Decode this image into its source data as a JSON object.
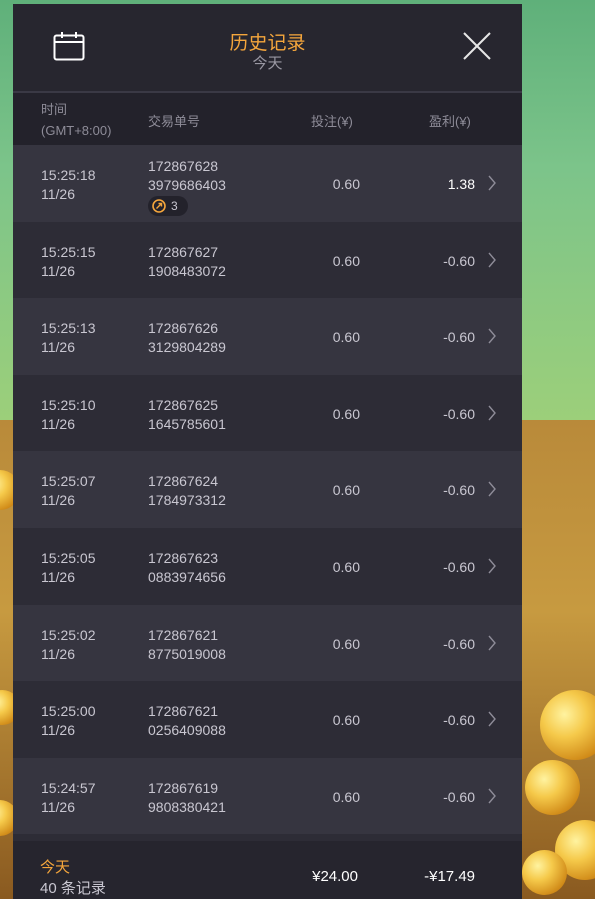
{
  "header": {
    "title": "历史记录",
    "subtitle": "今天"
  },
  "columns": {
    "time_label": "时间",
    "timezone": "(GMT+8:00)",
    "order_label": "交易单号",
    "bet_label": "投注(¥)",
    "profit_label": "盈利(¥)"
  },
  "records": [
    {
      "time": "15:25:18",
      "date": "11/26",
      "order_line1": "172867628",
      "order_line2": "3979686403",
      "bet": "0.60",
      "profit": "1.38",
      "badge_count": "3"
    },
    {
      "time": "15:25:15",
      "date": "11/26",
      "order_line1": "172867627",
      "order_line2": "1908483072",
      "bet": "0.60",
      "profit": "-0.60"
    },
    {
      "time": "15:25:13",
      "date": "11/26",
      "order_line1": "172867626",
      "order_line2": "3129804289",
      "bet": "0.60",
      "profit": "-0.60"
    },
    {
      "time": "15:25:10",
      "date": "11/26",
      "order_line1": "172867625",
      "order_line2": "1645785601",
      "bet": "0.60",
      "profit": "-0.60"
    },
    {
      "time": "15:25:07",
      "date": "11/26",
      "order_line1": "172867624",
      "order_line2": "1784973312",
      "bet": "0.60",
      "profit": "-0.60"
    },
    {
      "time": "15:25:05",
      "date": "11/26",
      "order_line1": "172867623",
      "order_line2": "0883974656",
      "bet": "0.60",
      "profit": "-0.60"
    },
    {
      "time": "15:25:02",
      "date": "11/26",
      "order_line1": "172867621",
      "order_line2": "8775019008",
      "bet": "0.60",
      "profit": "-0.60"
    },
    {
      "time": "15:25:00",
      "date": "11/26",
      "order_line1": "172867621",
      "order_line2": "0256409088",
      "bet": "0.60",
      "profit": "-0.60"
    },
    {
      "time": "15:24:57",
      "date": "11/26",
      "order_line1": "172867619",
      "order_line2": "9808380421",
      "bet": "0.60",
      "profit": "-0.60"
    }
  ],
  "footer": {
    "period": "今天",
    "record_count": "40 条记录",
    "total_bet": "¥24.00",
    "total_profit": "-¥17.49"
  },
  "colors": {
    "accent": "#f5a63c",
    "panel_bg": "#2d2c36",
    "row_alt_bg": "#363540",
    "text": "#c9c7d1"
  },
  "icons": {
    "calendar": "calendar-icon",
    "close": "close-icon",
    "chevron": "chevron-right-icon",
    "badge": "free-spin-icon"
  }
}
